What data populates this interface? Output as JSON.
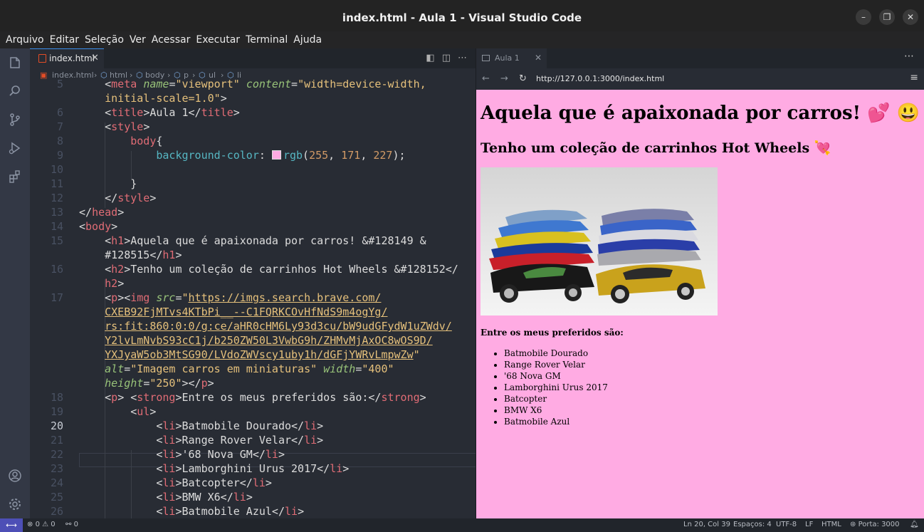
{
  "window": {
    "title": "index.html - Aula 1 - Visual Studio Code"
  },
  "menu": [
    "Arquivo",
    "Editar",
    "Seleção",
    "Ver",
    "Acessar",
    "Executar",
    "Terminal",
    "Ajuda"
  ],
  "editor": {
    "tab_label": "index.html",
    "breadcrumb": [
      "index.html",
      "html",
      "body",
      "p",
      "ul",
      "li"
    ],
    "lines": [
      {
        "n": "5",
        "html": "    <span class='p'>&lt;</span><span class='t'>meta</span> <span class='a'>name</span><span class='p'>=</span><span class='s'>\"viewport\"</span> <span class='a'>content</span><span class='p'>=</span><span class='s'>\"width=device-width,</span>"
      },
      {
        "n": "",
        "html": "    <span class='s'>initial-scale=1.0\"</span><span class='p'>&gt;</span>"
      },
      {
        "n": "6",
        "html": "    <span class='p'>&lt;</span><span class='t'>title</span><span class='p'>&gt;Aula 1&lt;/</span><span class='t'>title</span><span class='p'>&gt;</span>"
      },
      {
        "n": "7",
        "html": "    <span class='p'>&lt;</span><span class='t'>style</span><span class='p'>&gt;</span>"
      },
      {
        "n": "8",
        "html": "        <span class='t'>body</span><span class='p'>{</span>"
      },
      {
        "n": "9",
        "html": "            <span class='pr'>background-color</span><span class='p'>: </span><span class='swatch'></span><span class='pr'>rgb</span><span class='p'>(</span><span class='n'>255</span><span class='p'>, </span><span class='n'>171</span><span class='p'>, </span><span class='n'>227</span><span class='p'>);</span>"
      },
      {
        "n": "10",
        "html": ""
      },
      {
        "n": "11",
        "html": "        <span class='p'>}</span>"
      },
      {
        "n": "12",
        "html": "    <span class='p'>&lt;/</span><span class='t'>style</span><span class='p'>&gt;</span>"
      },
      {
        "n": "13",
        "html": "<span class='p'>&lt;/</span><span class='t'>head</span><span class='p'>&gt;</span>"
      },
      {
        "n": "14",
        "html": "<span class='p'>&lt;</span><span class='t'>body</span><span class='p'>&gt;</span>"
      },
      {
        "n": "15",
        "html": "    <span class='p'>&lt;</span><span class='t'>h1</span><span class='p'>&gt;Aquela que é apaixonada por carros! &amp;#128149 &amp;</span>"
      },
      {
        "n": "",
        "html": "    <span class='p'>#128515&lt;/</span><span class='t'>h1</span><span class='p'>&gt;</span>"
      },
      {
        "n": "16",
        "html": "    <span class='p'>&lt;</span><span class='t'>h2</span><span class='p'>&gt;Tenho um coleção de carrinhos Hot Wheels &amp;#128152&lt;/</span>"
      },
      {
        "n": "",
        "html": "    <span class='t'>h2</span><span class='p'>&gt;</span>"
      },
      {
        "n": "17",
        "html": "    <span class='p'>&lt;</span><span class='t'>p</span><span class='p'>&gt;&lt;</span><span class='t'>img</span> <span class='a'>src</span><span class='p'>=</span><span class='s'>\"</span><span class='u'>https://imgs.search.brave.com/</span>"
      },
      {
        "n": "",
        "html": "    <span class='u'>CXEB92FjMTvs4KTbPi__--C1FQRKCOvHfNdS9m4ogYg/</span>"
      },
      {
        "n": "",
        "html": "    <span class='u'>rs:fit:860:0:0/g:ce/aHR0cHM6Ly93d3cu/bW9udGFydW1uZWdv/</span>"
      },
      {
        "n": "",
        "html": "    <span class='u'>Y2lvLmNvbS93cC1j/b250ZW50L3VwbG9h/ZHMvMjAxOC8wOS9D/</span>"
      },
      {
        "n": "",
        "html": "    <span class='u'>YXJyaW5ob3MtSG90/LVdoZWVscy1uby1h/dGFjYWRvLmpwZw</span><span class='s'>\"</span>"
      },
      {
        "n": "",
        "html": "    <span class='a'>alt</span><span class='p'>=</span><span class='s'>\"Imagem carros em miniaturas\"</span> <span class='a'>width</span><span class='p'>=</span><span class='s'>\"400\"</span>"
      },
      {
        "n": "",
        "html": "    <span class='a'>height</span><span class='p'>=</span><span class='s'>\"250\"</span><span class='p'>&gt;&lt;/</span><span class='t'>p</span><span class='p'>&gt;</span>"
      },
      {
        "n": "18",
        "html": "    <span class='p'>&lt;</span><span class='t'>p</span><span class='p'>&gt; &lt;</span><span class='t'>strong</span><span class='p'>&gt;Entre os meus preferidos são:&lt;/</span><span class='t'>strong</span><span class='p'>&gt;</span>"
      },
      {
        "n": "19",
        "html": "        <span class='p'>&lt;</span><span class='t'>ul</span><span class='p'>&gt;</span>"
      },
      {
        "n": "20",
        "html": "            <span class='p'>&lt;</span><span class='t'>li</span><span class='p'>&gt;Batmobile Dourado&lt;/</span><span class='t'>li</span><span class='p'>&gt;</span>"
      },
      {
        "n": "21",
        "html": "            <span class='p'>&lt;</span><span class='t'>li</span><span class='p'>&gt;Range Rover Velar&lt;/</span><span class='t'>li</span><span class='p'>&gt;</span>"
      },
      {
        "n": "22",
        "html": "            <span class='p'>&lt;</span><span class='t'>li</span><span class='p'>&gt;'68 Nova GM&lt;/</span><span class='t'>li</span><span class='p'>&gt;</span>"
      },
      {
        "n": "23",
        "html": "            <span class='p'>&lt;</span><span class='t'>li</span><span class='p'>&gt;Lamborghini Urus 2017&lt;/</span><span class='t'>li</span><span class='p'>&gt;</span>"
      },
      {
        "n": "24",
        "html": "            <span class='p'>&lt;</span><span class='t'>li</span><span class='p'>&gt;Batcopter&lt;/</span><span class='t'>li</span><span class='p'>&gt;</span>"
      },
      {
        "n": "25",
        "html": "            <span class='p'>&lt;</span><span class='t'>li</span><span class='p'>&gt;BMW X6&lt;/</span><span class='t'>li</span><span class='p'>&gt;</span>"
      },
      {
        "n": "26",
        "html": "            <span class='p'>&lt;</span><span class='t'>li</span><span class='p'>&gt;Batmobile Azul&lt;/</span><span class='t'>li</span><span class='p'>&gt;</span>"
      }
    ],
    "current_line": "20"
  },
  "preview": {
    "tab_label": "Aula 1",
    "url": "http://127.0.0.1:3000/index.html",
    "h1": "Aquela que é apaixonada por carros! 💕 😃",
    "h2": "Tenho um coleção de carrinhos Hot Wheels 💘",
    "img_alt": "Imagem carros em miniaturas",
    "strong": "Entre os meus preferidos são:",
    "items": [
      "Batmobile Dourado",
      "Range Rover Velar",
      "'68 Nova GM",
      "Lamborghini Urus 2017",
      "Batcopter",
      "BMW X6",
      "Batmobile Azul"
    ]
  },
  "status": {
    "errors": "0",
    "warnings": "0",
    "ports": "0",
    "position": "Ln 20, Col 39",
    "spaces": "Espaços: 4",
    "encoding": "UTF-8",
    "eol": "LF",
    "language": "HTML",
    "port": "Porta: 3000"
  },
  "colors": {
    "page_bg": "#ffabe3",
    "accent": "#3b8eea"
  }
}
